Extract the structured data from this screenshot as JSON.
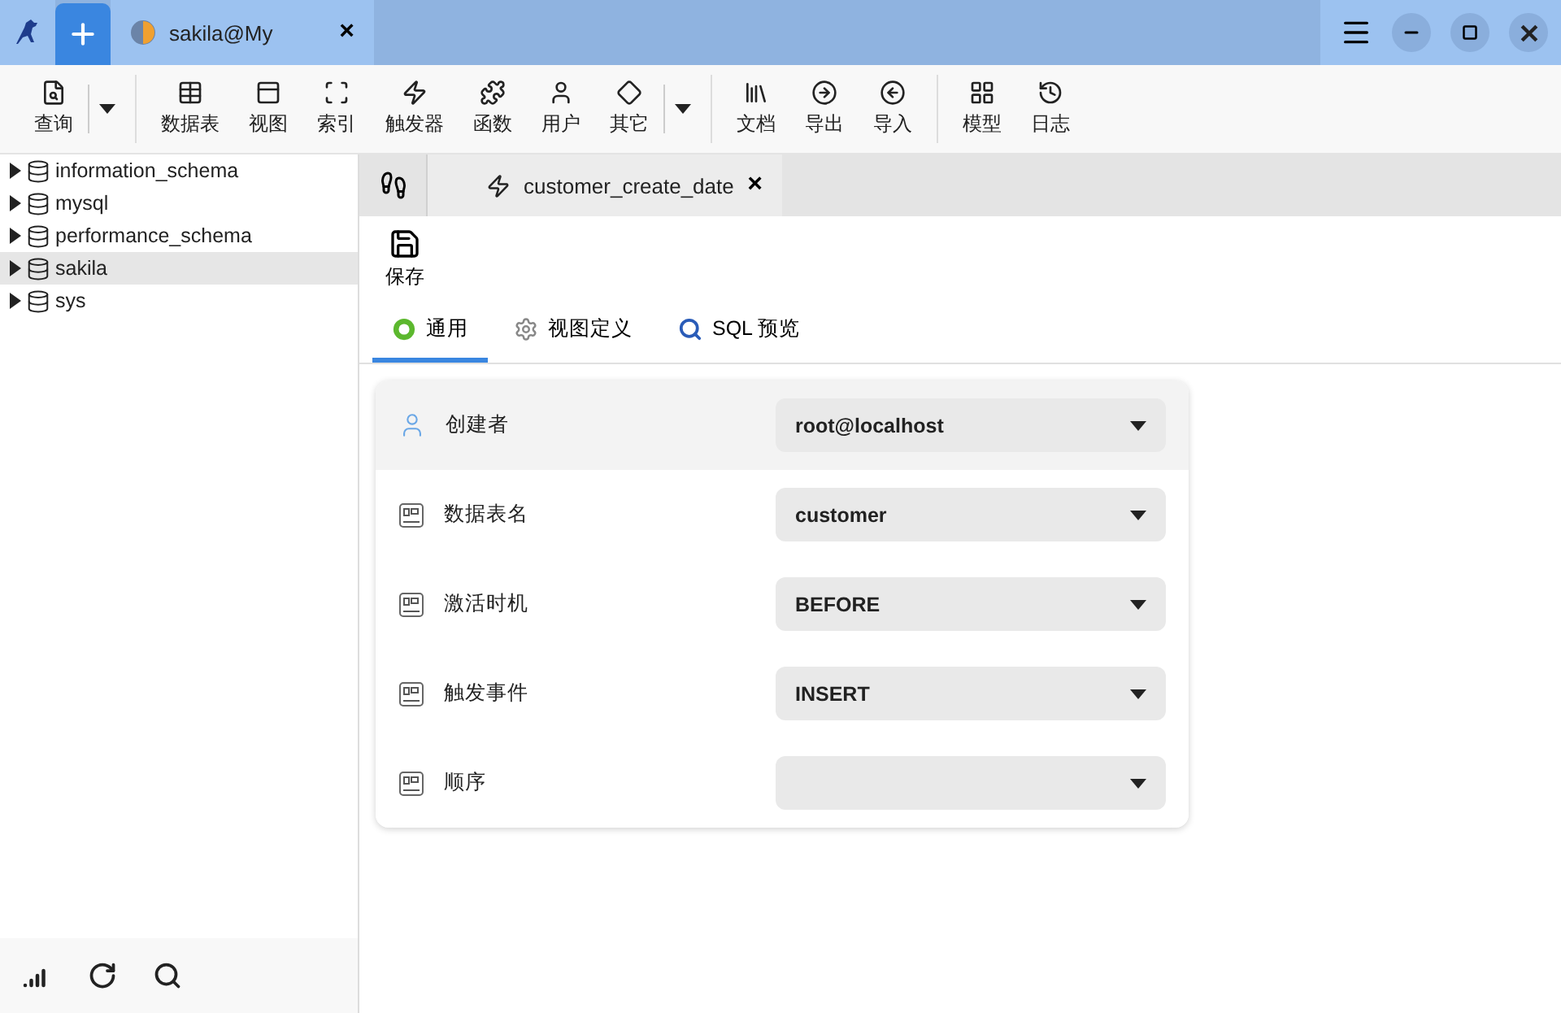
{
  "window": {
    "tab": {
      "title": "sakila@My",
      "close": "×"
    }
  },
  "toolbar": {
    "groups": [
      [
        {
          "label": "查询",
          "dropdown": true
        }
      ],
      [
        {
          "label": "数据表",
          "dropdown": false
        },
        {
          "label": "视图",
          "dropdown": false
        },
        {
          "label": "索引",
          "dropdown": false
        },
        {
          "label": "触发器",
          "dropdown": false
        },
        {
          "label": "函数",
          "dropdown": false
        },
        {
          "label": "用户",
          "dropdown": false
        },
        {
          "label": "其它",
          "dropdown": true
        }
      ],
      [
        {
          "label": "文档",
          "dropdown": false
        },
        {
          "label": "导出",
          "dropdown": false
        },
        {
          "label": "导入",
          "dropdown": false
        }
      ],
      [
        {
          "label": "模型",
          "dropdown": false
        },
        {
          "label": "日志",
          "dropdown": false
        }
      ]
    ]
  },
  "sidebar": {
    "items": [
      {
        "label": "information_schema",
        "selected": false,
        "expanded": false
      },
      {
        "label": "mysql",
        "selected": false,
        "expanded": false
      },
      {
        "label": "performance_schema",
        "selected": false,
        "expanded": false
      },
      {
        "label": "sakila",
        "selected": true,
        "expanded": false
      },
      {
        "label": "sys",
        "selected": false,
        "expanded": false
      }
    ]
  },
  "editor_tab": {
    "title": "customer_create_date",
    "close": "×"
  },
  "save_button": "保存",
  "sub_tabs": [
    {
      "label": "通用",
      "selected": true
    },
    {
      "label": "视图定义",
      "selected": false
    },
    {
      "label": "SQL 预览",
      "selected": false
    }
  ],
  "form": {
    "rows": [
      {
        "kind": "user",
        "label": "创建者",
        "value": "root@localhost",
        "selected": true
      },
      {
        "kind": "field",
        "label": "数据表名",
        "value": "customer",
        "selected": false
      },
      {
        "kind": "field",
        "label": "激活时机",
        "value": "BEFORE",
        "selected": false
      },
      {
        "kind": "field",
        "label": "触发事件",
        "value": "INSERT",
        "selected": false
      },
      {
        "kind": "field",
        "label": "顺序",
        "selected": false
      }
    ]
  }
}
